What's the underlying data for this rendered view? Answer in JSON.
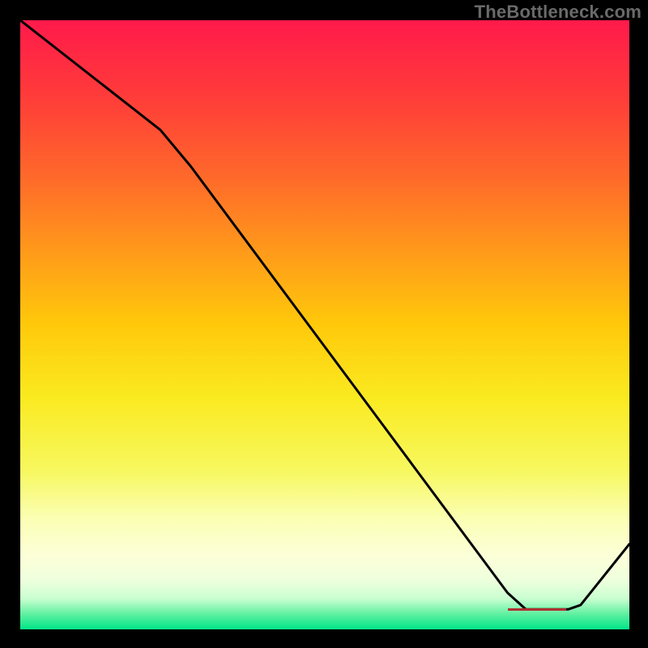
{
  "watermark": "TheBottleneck.com",
  "dash_label": "▬▬▬▬▬▬▬▬▬▬▬▬▬▬",
  "chart_data": {
    "type": "line",
    "title": "",
    "xlabel": "",
    "ylabel": "",
    "xlim": [
      0,
      100
    ],
    "ylim": [
      0,
      100
    ],
    "grid": false,
    "legend": false,
    "gradient_stops": [
      {
        "pos": 0,
        "color": "#ff1a4b"
      },
      {
        "pos": 12,
        "color": "#ff3a3a"
      },
      {
        "pos": 26,
        "color": "#ff6a2a"
      },
      {
        "pos": 38,
        "color": "#ff9a1a"
      },
      {
        "pos": 50,
        "color": "#ffc90a"
      },
      {
        "pos": 62,
        "color": "#faea20"
      },
      {
        "pos": 74,
        "color": "#f7f860"
      },
      {
        "pos": 82,
        "color": "#fbffb5"
      },
      {
        "pos": 88,
        "color": "#fcffd8"
      },
      {
        "pos": 92,
        "color": "#eeffdd"
      },
      {
        "pos": 95,
        "color": "#c8ffd0"
      },
      {
        "pos": 97.5,
        "color": "#5ff0a0"
      },
      {
        "pos": 100,
        "color": "#00e688"
      }
    ],
    "series": [
      {
        "name": "bottleneck-curve",
        "color": "#000000",
        "points": [
          {
            "x": 0,
            "y": 100
          },
          {
            "x": 23,
            "y": 82
          },
          {
            "x": 28,
            "y": 76
          },
          {
            "x": 80,
            "y": 6
          },
          {
            "x": 83,
            "y": 3.3
          },
          {
            "x": 90,
            "y": 3.3
          },
          {
            "x": 92,
            "y": 4
          },
          {
            "x": 100,
            "y": 14
          }
        ]
      }
    ],
    "marker": {
      "x_start": 80,
      "x_end": 90,
      "y": 3.3,
      "color": "#b03030"
    }
  }
}
